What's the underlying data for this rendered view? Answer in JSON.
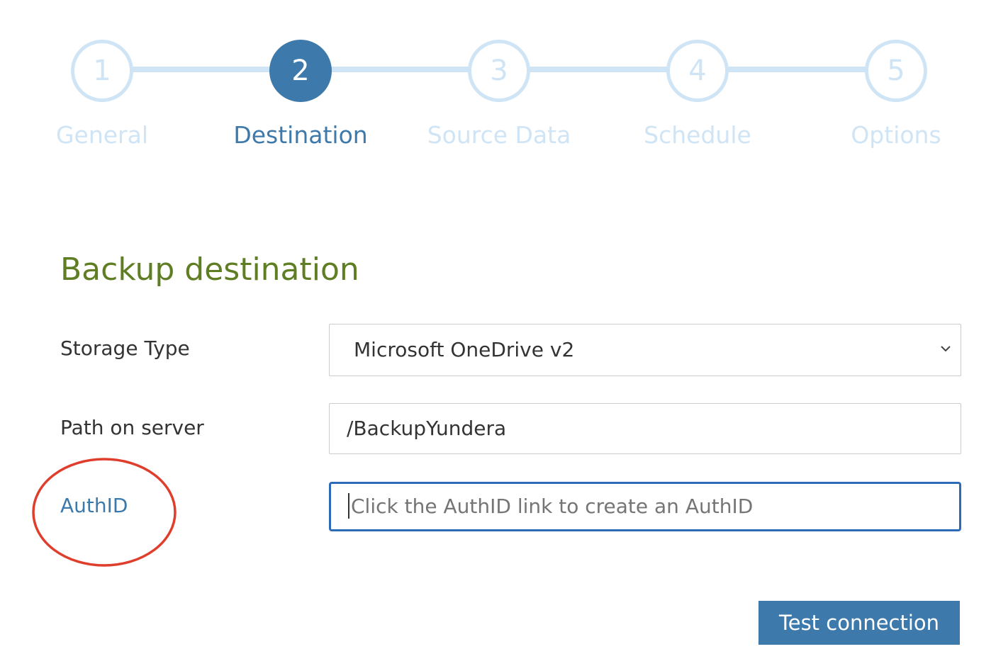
{
  "wizard": {
    "active_step": 2,
    "steps": [
      {
        "number": "1",
        "label": "General"
      },
      {
        "number": "2",
        "label": "Destination"
      },
      {
        "number": "3",
        "label": "Source Data"
      },
      {
        "number": "4",
        "label": "Schedule"
      },
      {
        "number": "5",
        "label": "Options"
      }
    ]
  },
  "section": {
    "title": "Backup destination"
  },
  "form": {
    "storage_type": {
      "label": "Storage Type",
      "value": "Microsoft OneDrive v2"
    },
    "path": {
      "label": "Path on server",
      "value": "/BackupYundera"
    },
    "authid": {
      "label": "AuthID",
      "value": "",
      "placeholder": "Click the AuthID link to create an AuthID"
    }
  },
  "actions": {
    "test_connection": "Test connection"
  },
  "colors": {
    "accent": "#3d79aa",
    "step_inactive": "#cfe4f5",
    "section_title": "#5f7e23",
    "focus_border": "#2d6ab7",
    "annotation": "#e03e2d"
  },
  "icons": {
    "select_chevron": "chevron-down-icon"
  }
}
